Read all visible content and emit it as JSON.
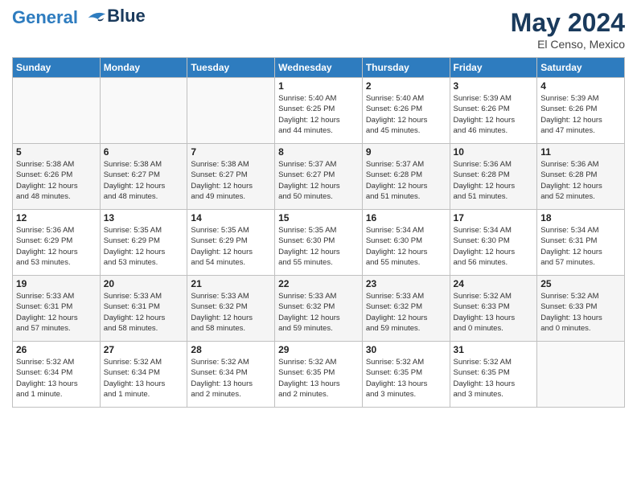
{
  "header": {
    "logo_line1": "General",
    "logo_line2": "Blue",
    "title": "May 2024",
    "location": "El Censo, Mexico"
  },
  "days_of_week": [
    "Sunday",
    "Monday",
    "Tuesday",
    "Wednesday",
    "Thursday",
    "Friday",
    "Saturday"
  ],
  "weeks": [
    [
      {
        "day": "",
        "info": ""
      },
      {
        "day": "",
        "info": ""
      },
      {
        "day": "",
        "info": ""
      },
      {
        "day": "1",
        "info": "Sunrise: 5:40 AM\nSunset: 6:25 PM\nDaylight: 12 hours\nand 44 minutes."
      },
      {
        "day": "2",
        "info": "Sunrise: 5:40 AM\nSunset: 6:26 PM\nDaylight: 12 hours\nand 45 minutes."
      },
      {
        "day": "3",
        "info": "Sunrise: 5:39 AM\nSunset: 6:26 PM\nDaylight: 12 hours\nand 46 minutes."
      },
      {
        "day": "4",
        "info": "Sunrise: 5:39 AM\nSunset: 6:26 PM\nDaylight: 12 hours\nand 47 minutes."
      }
    ],
    [
      {
        "day": "5",
        "info": "Sunrise: 5:38 AM\nSunset: 6:26 PM\nDaylight: 12 hours\nand 48 minutes."
      },
      {
        "day": "6",
        "info": "Sunrise: 5:38 AM\nSunset: 6:27 PM\nDaylight: 12 hours\nand 48 minutes."
      },
      {
        "day": "7",
        "info": "Sunrise: 5:38 AM\nSunset: 6:27 PM\nDaylight: 12 hours\nand 49 minutes."
      },
      {
        "day": "8",
        "info": "Sunrise: 5:37 AM\nSunset: 6:27 PM\nDaylight: 12 hours\nand 50 minutes."
      },
      {
        "day": "9",
        "info": "Sunrise: 5:37 AM\nSunset: 6:28 PM\nDaylight: 12 hours\nand 51 minutes."
      },
      {
        "day": "10",
        "info": "Sunrise: 5:36 AM\nSunset: 6:28 PM\nDaylight: 12 hours\nand 51 minutes."
      },
      {
        "day": "11",
        "info": "Sunrise: 5:36 AM\nSunset: 6:28 PM\nDaylight: 12 hours\nand 52 minutes."
      }
    ],
    [
      {
        "day": "12",
        "info": "Sunrise: 5:36 AM\nSunset: 6:29 PM\nDaylight: 12 hours\nand 53 minutes."
      },
      {
        "day": "13",
        "info": "Sunrise: 5:35 AM\nSunset: 6:29 PM\nDaylight: 12 hours\nand 53 minutes."
      },
      {
        "day": "14",
        "info": "Sunrise: 5:35 AM\nSunset: 6:29 PM\nDaylight: 12 hours\nand 54 minutes."
      },
      {
        "day": "15",
        "info": "Sunrise: 5:35 AM\nSunset: 6:30 PM\nDaylight: 12 hours\nand 55 minutes."
      },
      {
        "day": "16",
        "info": "Sunrise: 5:34 AM\nSunset: 6:30 PM\nDaylight: 12 hours\nand 55 minutes."
      },
      {
        "day": "17",
        "info": "Sunrise: 5:34 AM\nSunset: 6:30 PM\nDaylight: 12 hours\nand 56 minutes."
      },
      {
        "day": "18",
        "info": "Sunrise: 5:34 AM\nSunset: 6:31 PM\nDaylight: 12 hours\nand 57 minutes."
      }
    ],
    [
      {
        "day": "19",
        "info": "Sunrise: 5:33 AM\nSunset: 6:31 PM\nDaylight: 12 hours\nand 57 minutes."
      },
      {
        "day": "20",
        "info": "Sunrise: 5:33 AM\nSunset: 6:31 PM\nDaylight: 12 hours\nand 58 minutes."
      },
      {
        "day": "21",
        "info": "Sunrise: 5:33 AM\nSunset: 6:32 PM\nDaylight: 12 hours\nand 58 minutes."
      },
      {
        "day": "22",
        "info": "Sunrise: 5:33 AM\nSunset: 6:32 PM\nDaylight: 12 hours\nand 59 minutes."
      },
      {
        "day": "23",
        "info": "Sunrise: 5:33 AM\nSunset: 6:32 PM\nDaylight: 12 hours\nand 59 minutes."
      },
      {
        "day": "24",
        "info": "Sunrise: 5:32 AM\nSunset: 6:33 PM\nDaylight: 13 hours\nand 0 minutes."
      },
      {
        "day": "25",
        "info": "Sunrise: 5:32 AM\nSunset: 6:33 PM\nDaylight: 13 hours\nand 0 minutes."
      }
    ],
    [
      {
        "day": "26",
        "info": "Sunrise: 5:32 AM\nSunset: 6:34 PM\nDaylight: 13 hours\nand 1 minute."
      },
      {
        "day": "27",
        "info": "Sunrise: 5:32 AM\nSunset: 6:34 PM\nDaylight: 13 hours\nand 1 minute."
      },
      {
        "day": "28",
        "info": "Sunrise: 5:32 AM\nSunset: 6:34 PM\nDaylight: 13 hours\nand 2 minutes."
      },
      {
        "day": "29",
        "info": "Sunrise: 5:32 AM\nSunset: 6:35 PM\nDaylight: 13 hours\nand 2 minutes."
      },
      {
        "day": "30",
        "info": "Sunrise: 5:32 AM\nSunset: 6:35 PM\nDaylight: 13 hours\nand 3 minutes."
      },
      {
        "day": "31",
        "info": "Sunrise: 5:32 AM\nSunset: 6:35 PM\nDaylight: 13 hours\nand 3 minutes."
      },
      {
        "day": "",
        "info": ""
      }
    ]
  ]
}
